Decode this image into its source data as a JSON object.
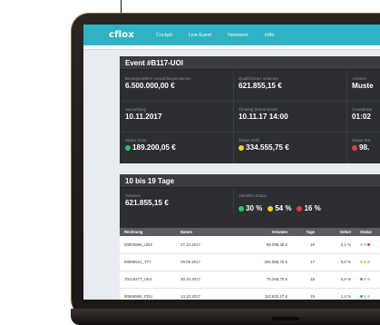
{
  "nav": {
    "logo": "cflox",
    "items": [
      {
        "label": "Cockpit",
        "active": false
      },
      {
        "label": "Live Event",
        "active": true
      },
      {
        "label": "Netzwerk",
        "active": false
      },
      {
        "label": "Hilfe",
        "active": false
      }
    ]
  },
  "event_card": {
    "title": "Event #B117-UOI",
    "row1": [
      {
        "label": "Bereitgestelltes Auszahlungsvolumen",
        "value": "6.500.000,00 €"
      },
      {
        "label": "Qualifiziertes Volumen",
        "value": "621.855,15 €"
      },
      {
        "label": "Anbieter",
        "value": "Muste"
      }
    ],
    "row2": [
      {
        "label": "Auszahlung",
        "value": "10.11.2017"
      },
      {
        "label": "Clearing (Event-Ende)",
        "value": "10.11.17 14:00"
      },
      {
        "label": "Countdown",
        "value": "01:02"
      }
    ],
    "row3": [
      {
        "label": "Status Grün",
        "value": "189.200,05 €",
        "dot": "green"
      },
      {
        "label": "Status Gelb",
        "value": "334.555,75 €",
        "dot": "yellow"
      },
      {
        "label": "Status Rot",
        "value": "98.",
        "dot": "red"
      }
    ]
  },
  "range_card": {
    "title": "10 bis 19 Tage",
    "volume_label": "Volumen",
    "volume_value": "621.855,15 €",
    "status_label": "Aktueller Status",
    "status": [
      {
        "pct": "30 %",
        "dot": "green"
      },
      {
        "pct": "54 %",
        "dot": "yellow"
      },
      {
        "pct": "16 %",
        "dot": "red"
      }
    ],
    "table": {
      "headers": [
        "Rechnung",
        "Datum",
        "Volumen",
        "Tage",
        "Gebot",
        "Status"
      ],
      "rows": [
        {
          "rechnung": "00803856_UBX",
          "datum": "27.10.2017",
          "volumen": "98.099,35 €",
          "tage": "16",
          "gebot": "0,1 %",
          "status": [
            "gray",
            "gray",
            "red"
          ]
        },
        {
          "rechnung": "80990621_T77",
          "datum": "29.09.2017",
          "volumen": "334.555,75 €",
          "tage": "17",
          "gebot": "0,6 %",
          "status": [
            "gray",
            "yellow",
            "gray"
          ]
        },
        {
          "rechnung": "70418477_UE4",
          "datum": "30.10.2017",
          "volumen": "78.366,78 €",
          "tage": "18",
          "gebot": "0,9 %",
          "status": [
            "green",
            "gray",
            "gray"
          ]
        },
        {
          "rechnung": "90866569_FDU",
          "datum": "13.10.2017",
          "volumen": "110.833,27 €",
          "tage": "19",
          "gebot": "1,4 %",
          "status": [
            "green",
            "gray",
            "gray"
          ]
        }
      ]
    }
  },
  "colors": {
    "green": "#25c46b",
    "yellow": "#f6d21a",
    "red": "#e8364a",
    "gray": "#c7cacd",
    "accent": "#2fb2c4"
  }
}
